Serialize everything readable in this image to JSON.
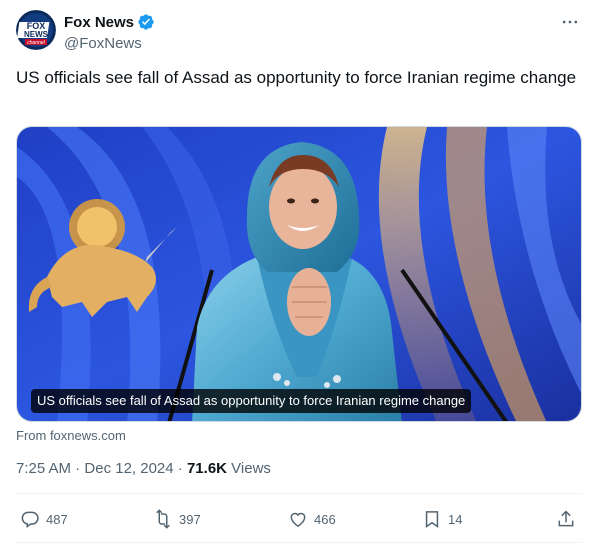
{
  "tweet": {
    "author": {
      "display_name": "Fox News",
      "handle": "@FoxNews",
      "avatar_lines": [
        "FOX",
        "NEWS",
        "channel"
      ]
    },
    "text": "US officials see fall of Assad as opportunity to force Iranian regime change",
    "card": {
      "caption": "US officials see fall of Assad as opportunity to force Iranian regime change",
      "source": "From foxnews.com"
    },
    "meta": {
      "time": "7:25 AM",
      "separator": " · ",
      "date": "Dec 12, 2024",
      "views_count": "71.6K",
      "views_label": "Views"
    },
    "actions": {
      "replies": "487",
      "reposts": "397",
      "likes": "466",
      "bookmarks": "14"
    }
  },
  "colors": {
    "text_primary": "#0f1419",
    "text_secondary": "#536471",
    "verified_blue": "#1d9bf0",
    "divider": "#eff3f4"
  },
  "icons": [
    "more-icon",
    "verified-icon",
    "reply-icon",
    "repost-icon",
    "like-icon",
    "bookmark-icon",
    "share-icon"
  ]
}
